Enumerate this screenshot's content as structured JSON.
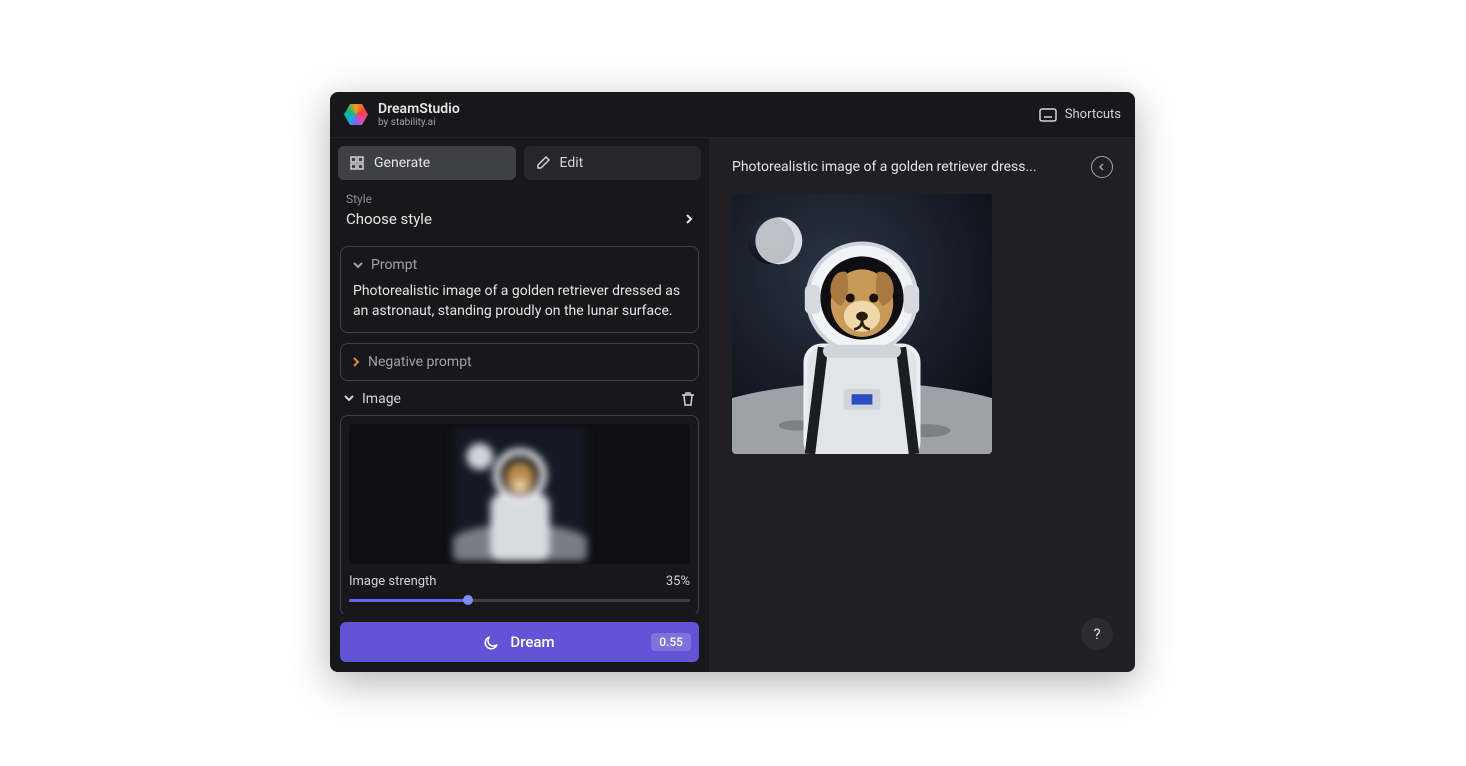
{
  "brand": {
    "name": "DreamStudio",
    "by_prefix": "by ",
    "by_link": "stability.ai"
  },
  "header": {
    "shortcuts_label": "Shortcuts"
  },
  "tabs": {
    "generate": "Generate",
    "edit": "Edit"
  },
  "style": {
    "label": "Style",
    "value": "Choose style"
  },
  "prompt": {
    "label": "Prompt",
    "text": "Photorealistic image of a golden retriever dressed as an astronaut, standing proudly on the lunar surface."
  },
  "negative_prompt": {
    "label": "Negative prompt"
  },
  "image_section": {
    "label": "Image",
    "strength_label": "Image strength",
    "strength_value": "35%",
    "strength_pct": 35
  },
  "dream": {
    "label": "Dream",
    "cost": "0.55"
  },
  "canvas": {
    "title_truncated": "Photorealistic image of a golden retriever dress..."
  },
  "help": {
    "label": "?"
  },
  "colors": {
    "accent": "#6154d7",
    "bg": "#18181b",
    "panel": "#202024",
    "border": "#3f3f46"
  }
}
